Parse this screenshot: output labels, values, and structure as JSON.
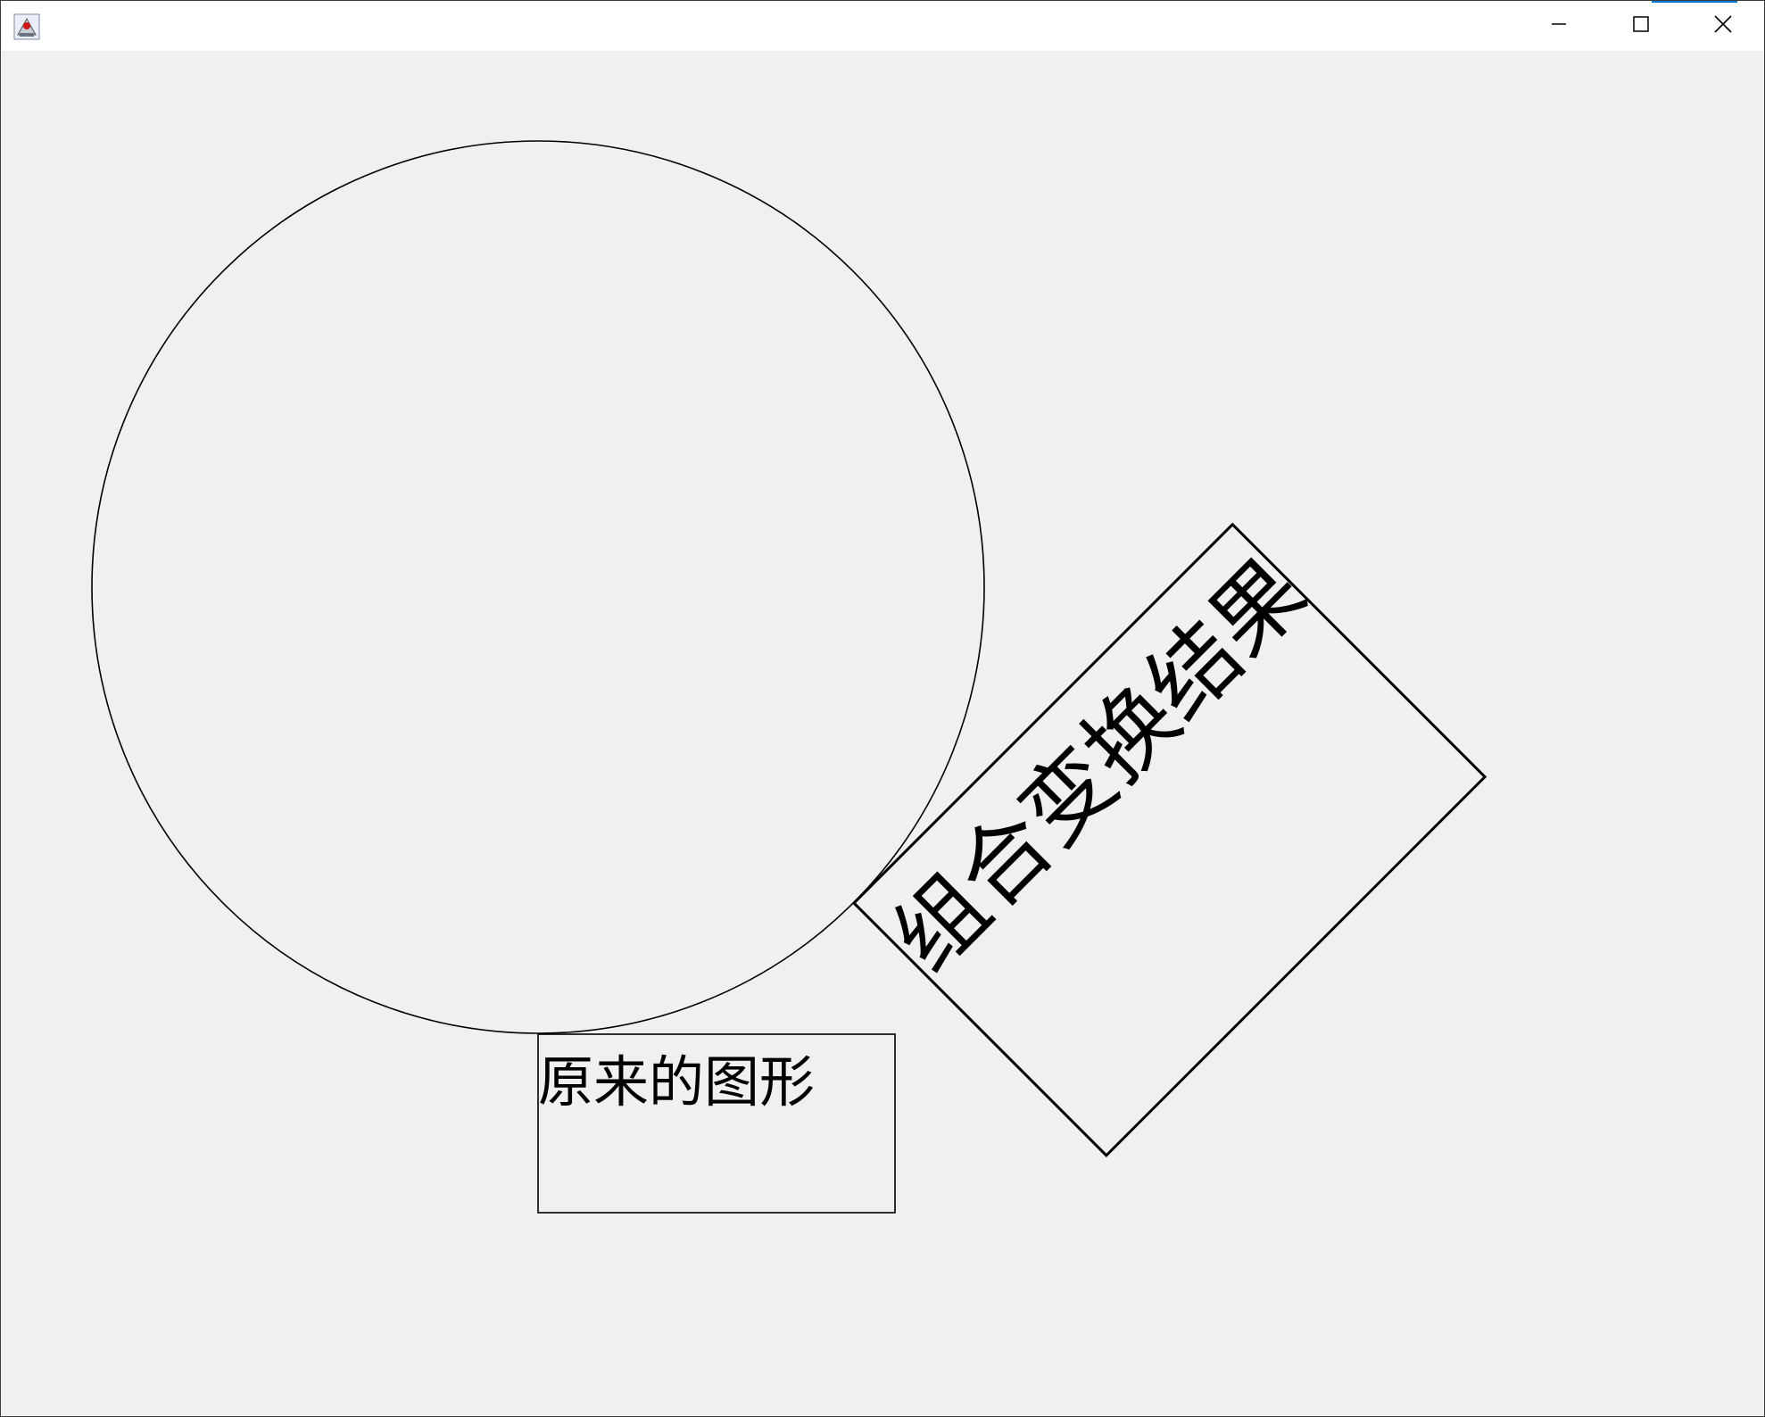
{
  "window": {
    "icons": {
      "app": "java-app-icon",
      "minimize": "minimize-icon",
      "maximize": "maximize-icon",
      "close": "close-icon"
    },
    "colors": {
      "titlebar_bg": "#ffffff",
      "client_bg": "#f0f0f0",
      "stroke": "#000000",
      "accent": "#0078d7"
    }
  },
  "canvas": {
    "original_label": "原来的图形",
    "transformed_label": "组合变换结果"
  }
}
